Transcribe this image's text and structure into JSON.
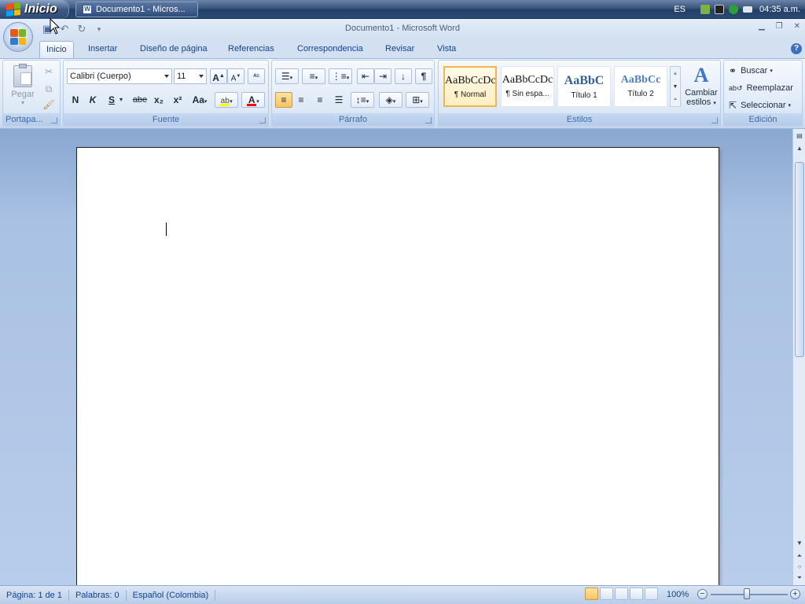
{
  "taskbar": {
    "start_label": "Inicio",
    "task_doc_label": "Documento1 - Micros...",
    "lang": "ES",
    "clock": "04:35 a.m."
  },
  "titlebar": {
    "title": "Documento1 - Microsoft Word"
  },
  "tabs": [
    {
      "label": "Inicio",
      "active": true
    },
    {
      "label": "Insertar"
    },
    {
      "label": "Diseño de página"
    },
    {
      "label": "Referencias"
    },
    {
      "label": "Correspondencia"
    },
    {
      "label": "Revisar"
    },
    {
      "label": "Vista"
    }
  ],
  "clipboard": {
    "paste_label": "Pegar",
    "group_label": "Portapa..."
  },
  "font": {
    "font_name": "Calibri (Cuerpo)",
    "font_size": "11",
    "bold": "N",
    "italic": "K",
    "underline": "S",
    "strike": "abe",
    "subscript": "x₂",
    "superscript": "x²",
    "change_case": "Aa",
    "group_label": "Fuente"
  },
  "paragraph": {
    "show_marks": "¶",
    "group_label": "Párrafo"
  },
  "styles": {
    "items": [
      {
        "sample": "AaBbCcDc",
        "caption": "¶ Normal",
        "selected": true
      },
      {
        "sample": "AaBbCcDc",
        "caption": "¶ Sin espa..."
      },
      {
        "sample": "AaBbC",
        "caption": "Título 1"
      },
      {
        "sample": "AaBbCc",
        "caption": "Título 2"
      }
    ],
    "change_styles_line1": "Cambiar",
    "change_styles_line2": "estilos",
    "group_label": "Estilos"
  },
  "editing": {
    "find": "Buscar",
    "replace": "Reemplazar",
    "select": "Seleccionar",
    "group_label": "Edición"
  },
  "statusbar": {
    "page": "Página: 1 de 1",
    "words": "Palabras: 0",
    "language": "Español (Colombia)",
    "zoom": "100%"
  },
  "colors": {
    "highlight": "#ffff00",
    "font_color": "#ff0000",
    "selected_accent": "#f1b64a"
  }
}
